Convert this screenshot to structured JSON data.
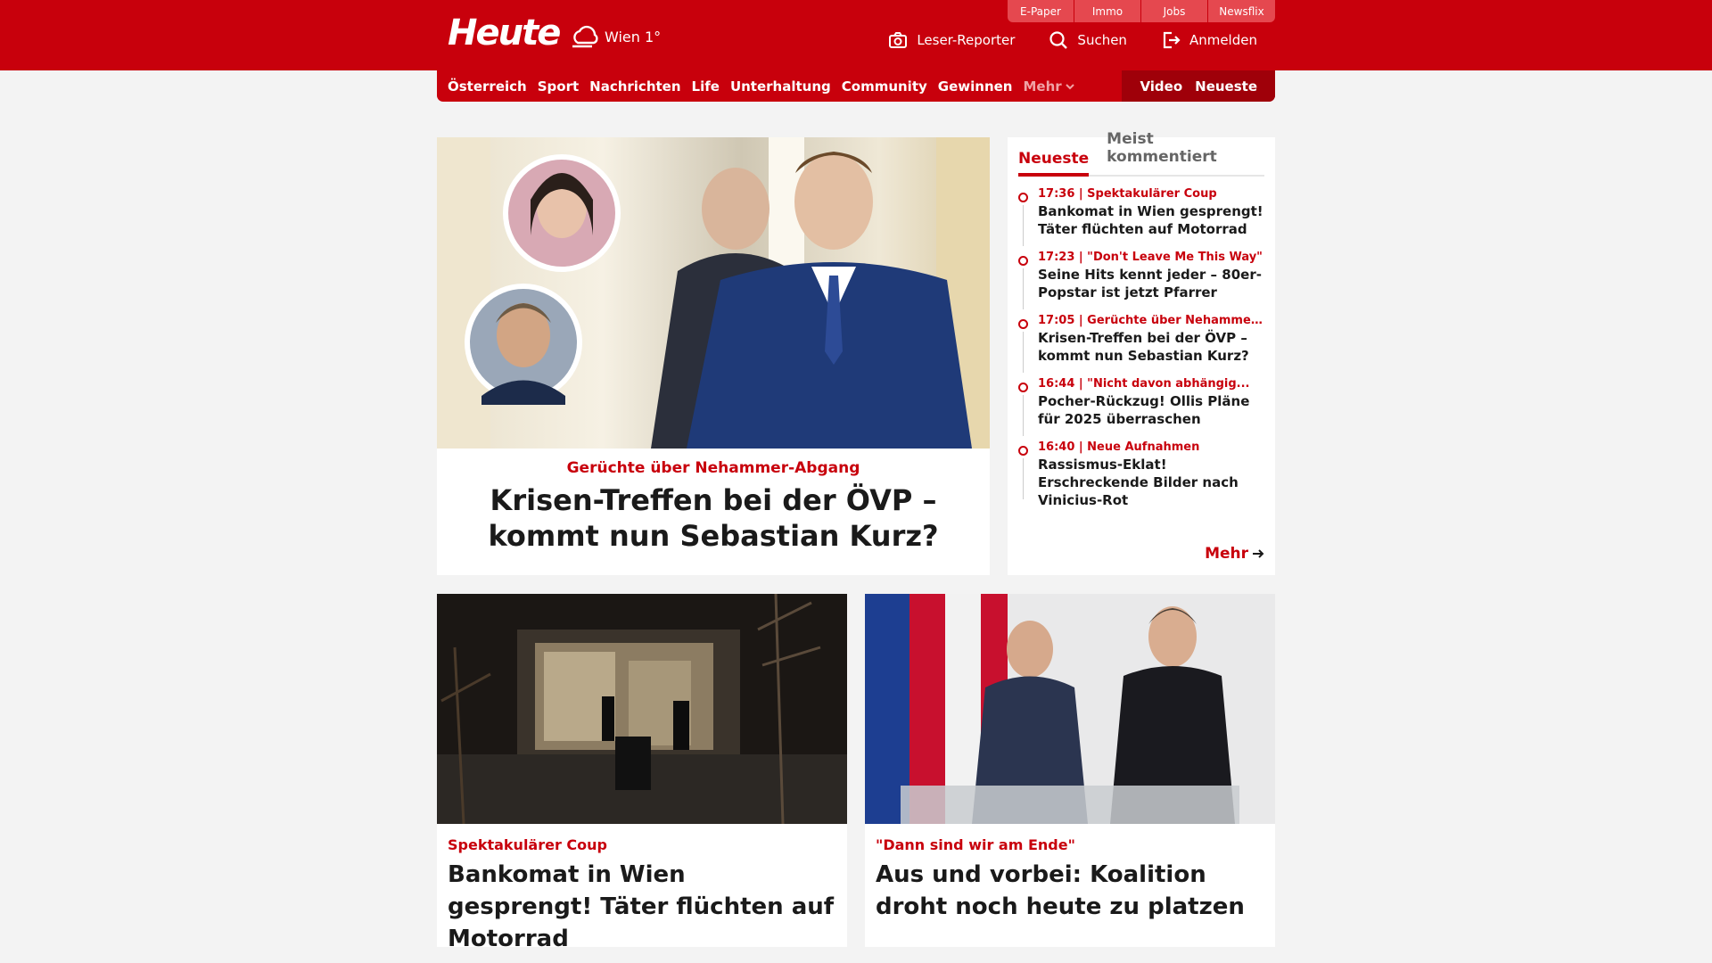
{
  "header": {
    "logo": "Heute",
    "weather": "Wien 1°",
    "top_tabs": [
      "E-Paper",
      "Immo",
      "Jobs",
      "Newsflix"
    ],
    "actions": {
      "reporter": "Leser-Reporter",
      "search": "Suchen",
      "login": "Anmelden"
    }
  },
  "nav": {
    "items": [
      "Österreich",
      "Sport",
      "Nachrichten",
      "Life",
      "Unterhaltung",
      "Community",
      "Gewinnen"
    ],
    "more": "Mehr",
    "right": [
      "Video",
      "Neueste"
    ]
  },
  "hero": {
    "kicker": "Gerüchte über Nehammer-Abgang",
    "title": "Krisen-Treffen bei der ÖVP – kommt nun Sebastian Kurz?"
  },
  "sidebar": {
    "tabs": [
      "Neueste",
      "Meist kommentiert"
    ],
    "items": [
      {
        "meta": "17:36 | Spektakulärer Coup",
        "title": "Bankomat in Wien gesprengt! Täter flüchten auf Motorrad"
      },
      {
        "meta": "17:23 | \"Don't Leave Me This Way\"",
        "title": "Seine Hits kennt jeder – 80er-Popstar ist jetzt Pfarrer"
      },
      {
        "meta": "17:05 | Gerüchte über Nehammer-...",
        "title": "Krisen-Treffen bei der ÖVP – kommt nun Sebastian Kurz?"
      },
      {
        "meta": "16:44 | \"Nicht davon abhängig...",
        "title": "Pocher-Rückzug! Ollis Pläne für 2025 überraschen"
      },
      {
        "meta": "16:40 | Neue Aufnahmen",
        "title": "Rassismus-Eklat! Erschreckende Bilder nach Vinicius-Rot"
      }
    ],
    "more": "Mehr"
  },
  "cards": [
    {
      "kicker": "Spektakulärer Coup",
      "title": "Bankomat in Wien gesprengt! Täter flüchten auf Motorrad"
    },
    {
      "kicker": "\"Dann sind wir am Ende\"",
      "title": "Aus und vorbei: Koalition droht noch heute zu platzen"
    }
  ],
  "colors": {
    "brand_red": "#c8000c",
    "nav_dark": "#9f0009",
    "background": "#f3f3f3"
  }
}
